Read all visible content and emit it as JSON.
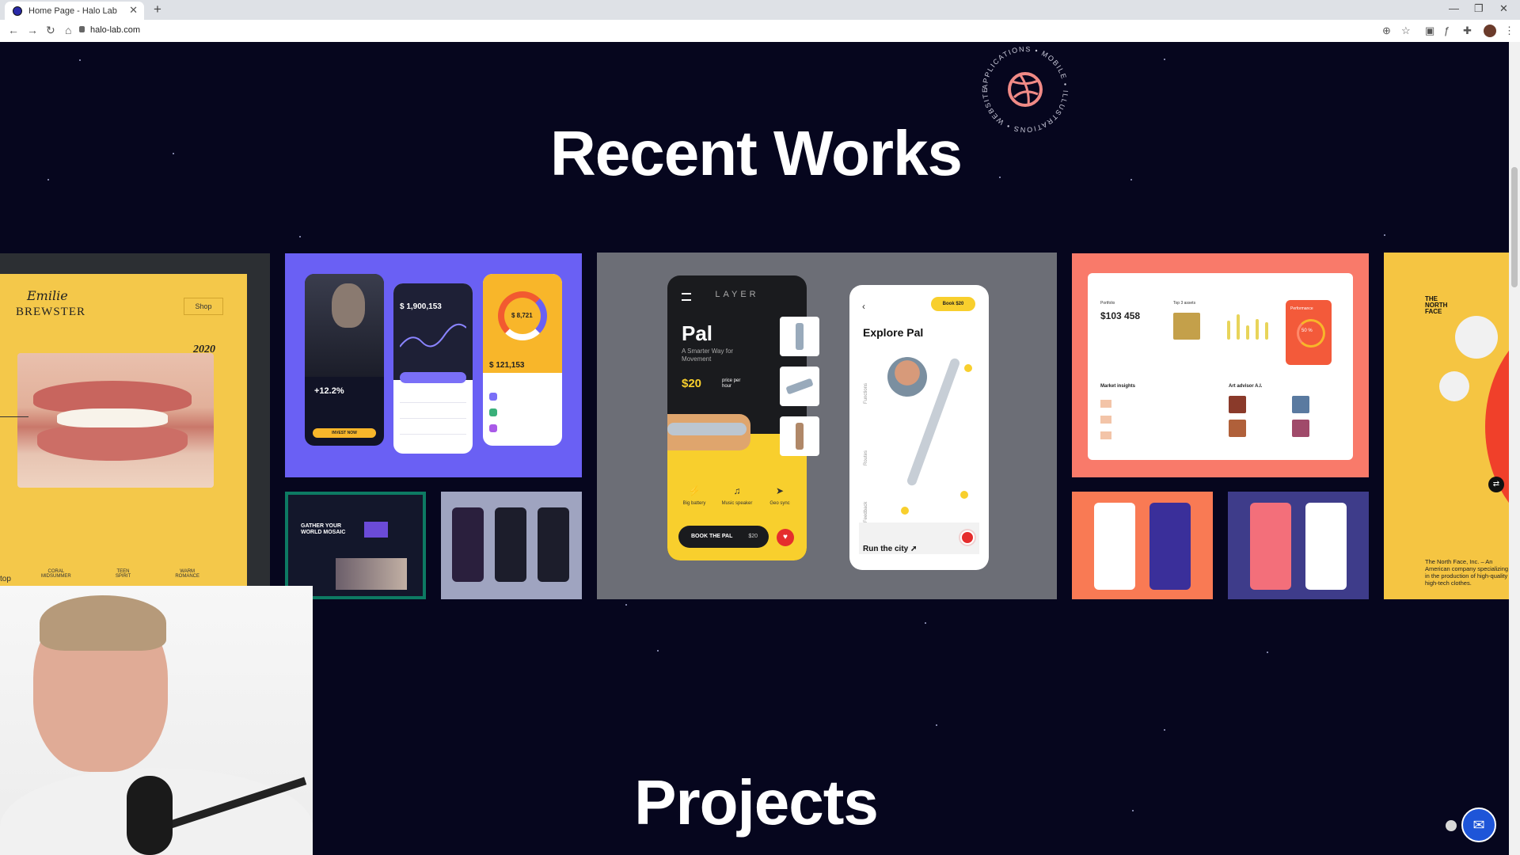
{
  "browser": {
    "tab_title": "Home Page - Halo Lab",
    "tab_close": "✕",
    "new_tab": "+",
    "url": "halo-lab.com",
    "nav": {
      "back": "←",
      "forward": "→",
      "reload": "↻",
      "home": "⌂"
    },
    "window": {
      "minimize": "—",
      "maximize": "❐",
      "close": "✕"
    },
    "toolbar_icons": [
      "plus-circle-icon",
      "star-icon",
      "extension-icon",
      "fx-icon",
      "puzzle-icon",
      "profile-icon",
      "menu-icon"
    ]
  },
  "page": {
    "section_title": "Recent Works",
    "next_section_title": "Projects",
    "badge": {
      "words": [
        "MOBILE",
        "ILLUSTRATIONS",
        "WEBSITES",
        "APPLICATIONS"
      ],
      "icon": "dribbble-icon"
    }
  },
  "works": {
    "brewster": {
      "script": "Emilie",
      "title": "BREWSTER",
      "shop": "Shop",
      "year": "2020",
      "labels": [
        "CORAL\nMIDSUMMER",
        "TEEN\nSPIRIT",
        "WARM\nROMANCE"
      ],
      "bottom": "top"
    },
    "finance": {
      "balance": "$ 1,900,153",
      "percent": "+12.2%",
      "invest": "INVEST NOW",
      "ring_amount": "$ 8,721",
      "total": "$ 121,153"
    },
    "mosaic": {
      "title": "GATHER YOUR WORLD MOSAIC"
    },
    "pal": {
      "brand": "LAYER",
      "title": "Pal",
      "subtitle": "A Smarter Way for Movement",
      "price": "$20",
      "price_unit": "price per hour",
      "features": [
        {
          "icon": "battery-icon",
          "glyph": "⚡",
          "label": "Big battery"
        },
        {
          "icon": "music-icon",
          "glyph": "♫",
          "label": "Music speaker"
        },
        {
          "icon": "location-icon",
          "glyph": "➤",
          "label": "Geo sync"
        }
      ],
      "book_label": "BOOK THE PAL",
      "book_price": "$20",
      "heart": "♥"
    },
    "explore": {
      "back": "‹",
      "book": "Book  $20",
      "title": "Explore Pal",
      "tabs": [
        "Functions",
        "Routes",
        "Feedback"
      ],
      "run": "Run the city ➚"
    },
    "dashboard": {
      "value": "$103 458",
      "section1": "Portfolio",
      "section2": "Top 3 assets",
      "perf": "Performance",
      "perf_value": "50 %",
      "market": "Market insights",
      "advisor": "Art advisor A.I."
    },
    "northface": {
      "logo": "THE\nNORTH\nFACE",
      "text": "The North Face, Inc. – An American company specializing in the production of high-quality high-tech clothes.",
      "control": "⇄"
    }
  },
  "chat": {
    "icon": "messenger-icon",
    "glyph": "✉"
  }
}
